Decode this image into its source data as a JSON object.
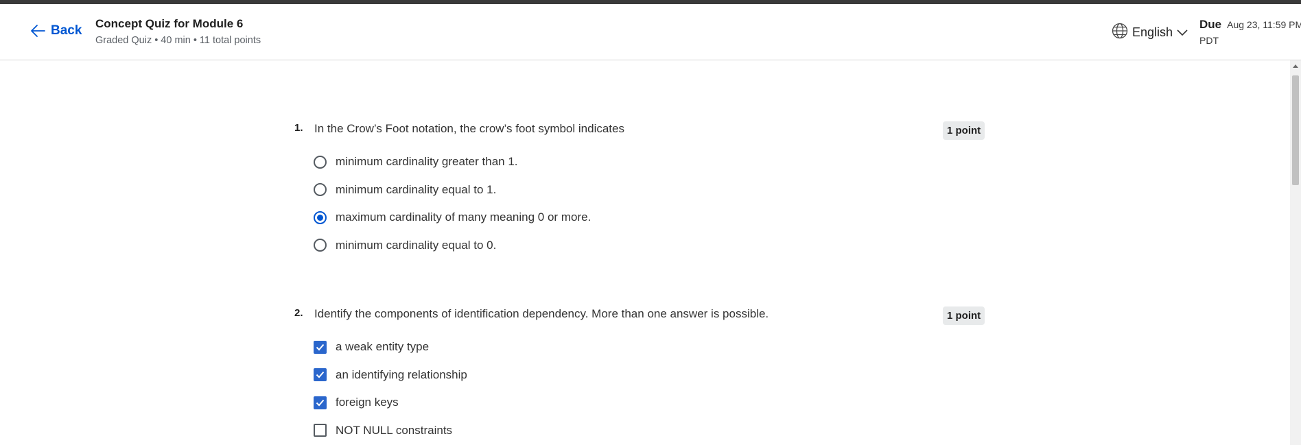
{
  "header": {
    "back_label": "Back",
    "title": "Concept Quiz for Module 6",
    "meta": {
      "type": "Graded Quiz",
      "duration": "40 min",
      "points": "11 total points",
      "separator": "•"
    },
    "language": "English",
    "due_label": "Due",
    "due_date": "Aug 23, 11:59 PM",
    "due_tz": "PDT"
  },
  "questions": [
    {
      "number": "1.",
      "text": "In the Crow’s Foot notation, the crow’s foot symbol indicates",
      "points": "1 point",
      "input_type": "radio",
      "options": [
        {
          "label": "minimum cardinality greater than 1.",
          "selected": false
        },
        {
          "label": "minimum cardinality equal to 1.",
          "selected": false
        },
        {
          "label": "maximum cardinality of many meaning 0 or more.",
          "selected": true
        },
        {
          "label": "minimum cardinality equal to 0.",
          "selected": false
        }
      ]
    },
    {
      "number": "2.",
      "text": "Identify the components of identification dependency. More than one answer is possible.",
      "points": "1 point",
      "input_type": "checkbox",
      "options": [
        {
          "label": "a weak entity type",
          "selected": true
        },
        {
          "label": "an identifying relationship",
          "selected": true
        },
        {
          "label": "foreign keys",
          "selected": true
        },
        {
          "label": "NOT NULL constraints",
          "selected": false
        }
      ]
    }
  ],
  "colors": {
    "accent": "#0056d2",
    "checkbox_fill": "#2a66cc",
    "points_badge_bg": "#e8eaeb",
    "top_strip": "#3a3a3a"
  }
}
